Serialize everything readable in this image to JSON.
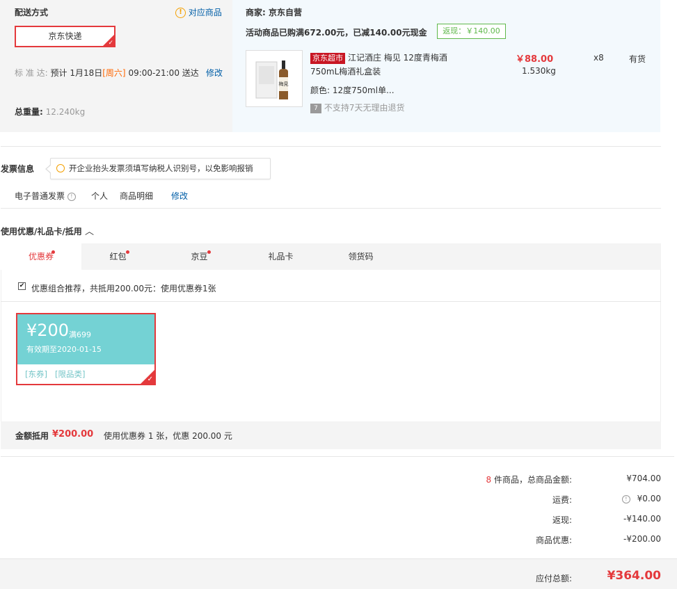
{
  "delivery": {
    "title": "配送方式",
    "match_link": "对应商品",
    "method": "京东快递",
    "standard_label": "标 准 达:",
    "estimate_prefix": "预计 1月18日",
    "weekday": "[周六]",
    "time_range": "09:00-21:00 送达",
    "modify": "修改",
    "weight_label": "总重量:",
    "weight_value": "12.240kg"
  },
  "merchant": {
    "label": "商家:",
    "name": "京东自营",
    "promo": "活动商品已购满672.00元，已减140.00元现金",
    "fanxian": "返现：￥140.00"
  },
  "product": {
    "tag": "京东超市",
    "name_line1": "江记酒庄 梅见 12度青梅酒",
    "name_line2": "750mL梅酒礼盒装",
    "color_label": "颜色:",
    "color_value": "12度750ml单...",
    "return_icon": "7",
    "return_note": "不支持7天无理由退货",
    "price": "￥88.00",
    "weight": "1.530kg",
    "qty": "x8",
    "stock": "有货",
    "image_icon": "whisky-bottle-icon",
    "image_text": "梅見"
  },
  "invoice": {
    "title": "发票信息",
    "tip": "开企业抬头发票须填写纳税人识别号，以免影响报销",
    "type": "电子普通发票",
    "owner": "个人",
    "content": "商品明细",
    "modify": "修改"
  },
  "discount": {
    "title": "使用优惠/礼品卡/抵用",
    "tabs": [
      {
        "label": "优惠券",
        "dot": true
      },
      {
        "label": "红包",
        "dot": true
      },
      {
        "label": "京豆",
        "dot": true
      },
      {
        "label": "礼品卡",
        "dot": false
      },
      {
        "label": "领货码",
        "dot": false
      }
    ],
    "recommend": "优惠组合推荐，共抵用200.00元：使用优惠券1张",
    "coupon": {
      "amount": "¥200",
      "condition": "满699",
      "expiry": "有效期至2020-01-15",
      "tag1": "[东券]",
      "tag2": "[限品类]"
    },
    "summary_label": "金额抵用",
    "summary_amount": "¥200.00",
    "summary_detail": "使用优惠券 1 张，优惠 200.00 元"
  },
  "totals": {
    "count": "8",
    "count_suffix": "件商品，总商品金额:",
    "goods_amount": "¥704.00",
    "shipping_label": "运费:",
    "shipping_amount": "¥0.00",
    "fanxian_label": "返现:",
    "fanxian_amount": "-¥140.00",
    "discount_label": "商品优惠:",
    "discount_amount": "-¥200.00",
    "payable_label": "应付总额:",
    "payable_amount": "¥364.00"
  },
  "colors": {
    "accent": "#e4393c",
    "link": "#005ea7",
    "coupon": "#74d2d4",
    "fanxian": "#5fb84b"
  }
}
